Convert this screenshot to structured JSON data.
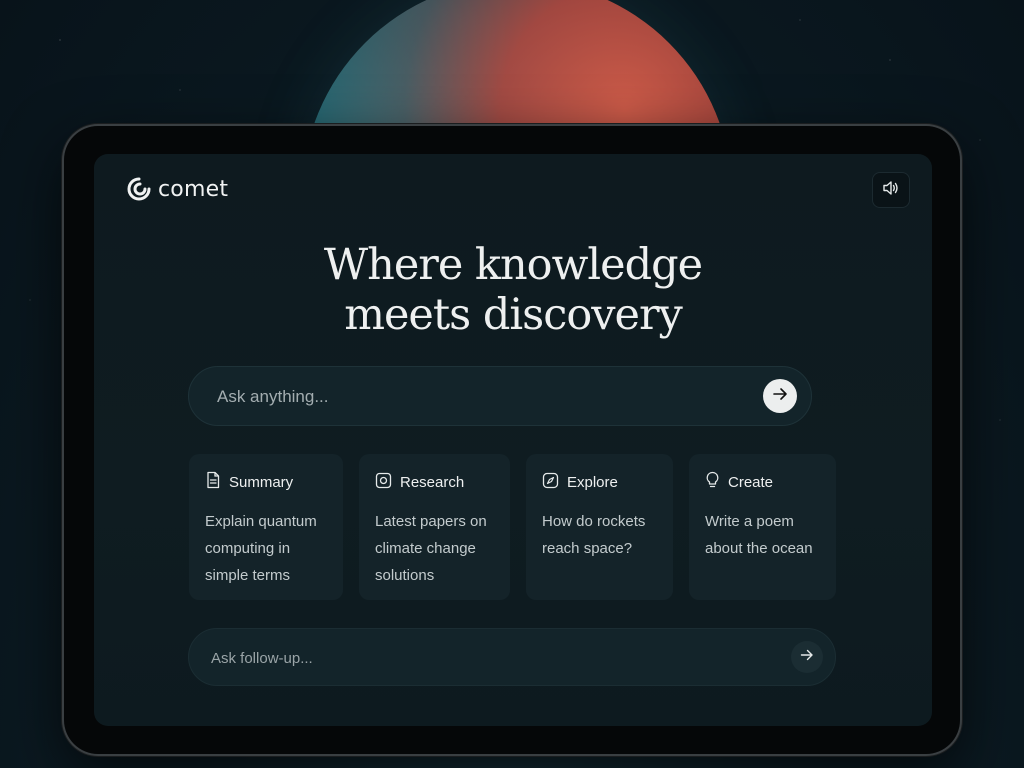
{
  "app": {
    "brand_name": "comet",
    "logo_icon": "comet-logo-icon"
  },
  "header": {
    "sound_icon": "speaker-icon"
  },
  "hero": {
    "headline_line1": "Where knowledge",
    "headline_line2": "meets discovery"
  },
  "search": {
    "placeholder": "Ask anything...",
    "submit_icon": "arrow-right-icon"
  },
  "suggestions": [
    {
      "icon": "document-icon",
      "title": "Summary",
      "prompt": "Explain quantum computing in simple terms"
    },
    {
      "icon": "camera-icon",
      "title": "Research",
      "prompt": "Latest papers on climate change solutions"
    },
    {
      "icon": "compass-icon",
      "title": "Explore",
      "prompt": "How do rockets reach space?"
    },
    {
      "icon": "lightbulb-icon",
      "title": "Create",
      "prompt": "Write a poem about the ocean"
    }
  ],
  "followup": {
    "placeholder": "Ask follow-up...",
    "submit_icon": "arrow-right-icon"
  },
  "colors": {
    "background": "#0c1c24",
    "screen": "#0f1c21",
    "card": "#142329",
    "text": "#eef0f0",
    "muted_text": "#c3cbcd",
    "send_button": "#eceeee"
  }
}
